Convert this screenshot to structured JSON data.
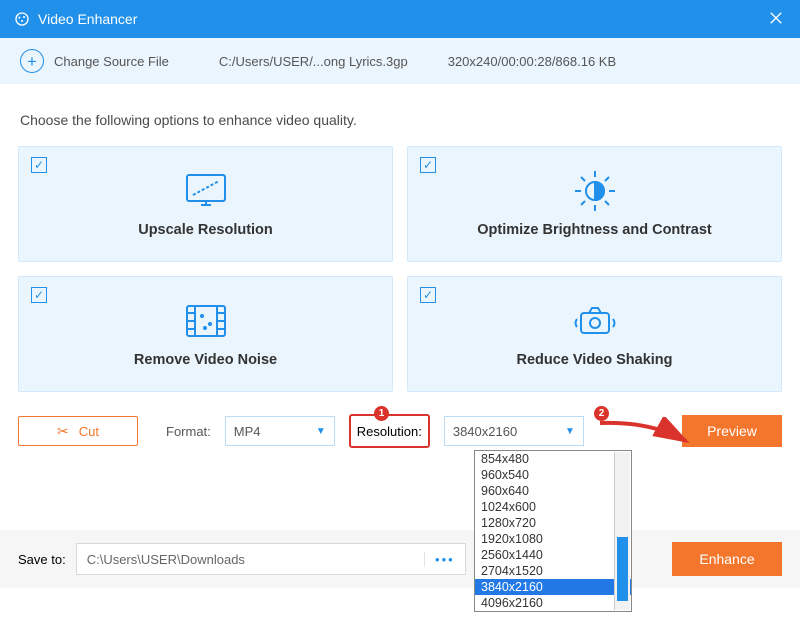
{
  "titlebar": {
    "title": "Video Enhancer"
  },
  "subbar": {
    "change_label": "Change Source File",
    "path": "C:/Users/USER/...ong Lyrics.3gp",
    "meta": "320x240/00:00:28/868.16 KB"
  },
  "desc": "Choose the following options to enhance video quality.",
  "cards": {
    "upscale": "Upscale Resolution",
    "brightness": "Optimize Brightness and Contrast",
    "noise": "Remove Video Noise",
    "shaking": "Reduce Video Shaking"
  },
  "controls": {
    "cut": "Cut",
    "format_label": "Format:",
    "format_value": "MP4",
    "resolution_label": "Resolution:",
    "resolution_value": "3840x2160",
    "preview": "Preview"
  },
  "badges": {
    "b1": "1",
    "b2": "2"
  },
  "dropdown": {
    "options": [
      "854x480",
      "960x540",
      "960x640",
      "1024x600",
      "1280x720",
      "1920x1080",
      "2560x1440",
      "2704x1520",
      "3840x2160",
      "4096x2160"
    ],
    "selected": "3840x2160"
  },
  "save": {
    "label": "Save to:",
    "path": "C:\\Users\\USER\\Downloads",
    "enhance": "Enhance"
  }
}
